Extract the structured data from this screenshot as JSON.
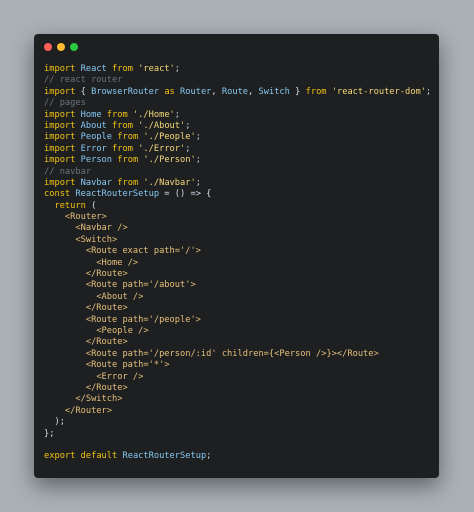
{
  "window": {
    "controls": [
      "close",
      "minimize",
      "zoom"
    ],
    "colors": {
      "background": "#1e1f21",
      "page": "#a9b0b6"
    }
  },
  "code": {
    "lines": [
      [
        [
          "kw",
          "import"
        ],
        [
          "plain",
          " "
        ],
        [
          "ident",
          "React"
        ],
        [
          "plain",
          " "
        ],
        [
          "kw",
          "from"
        ],
        [
          "plain",
          " "
        ],
        [
          "str",
          "'react'"
        ],
        [
          "punc",
          ";"
        ]
      ],
      [
        [
          "com",
          "// react router"
        ]
      ],
      [
        [
          "kw",
          "import"
        ],
        [
          "plain",
          " { "
        ],
        [
          "ident",
          "BrowserRouter"
        ],
        [
          "plain",
          " "
        ],
        [
          "kw",
          "as"
        ],
        [
          "plain",
          " "
        ],
        [
          "ident",
          "Router"
        ],
        [
          "plain",
          ", "
        ],
        [
          "ident",
          "Route"
        ],
        [
          "plain",
          ", "
        ],
        [
          "ident",
          "Switch"
        ],
        [
          "plain",
          " } "
        ],
        [
          "kw",
          "from"
        ],
        [
          "plain",
          " "
        ],
        [
          "str",
          "'react-router-dom'"
        ],
        [
          "punc",
          ";"
        ]
      ],
      [
        [
          "com",
          "// pages"
        ]
      ],
      [
        [
          "kw",
          "import"
        ],
        [
          "plain",
          " "
        ],
        [
          "ident",
          "Home"
        ],
        [
          "plain",
          " "
        ],
        [
          "kw",
          "from"
        ],
        [
          "plain",
          " "
        ],
        [
          "str",
          "'./Home'"
        ],
        [
          "punc",
          ";"
        ]
      ],
      [
        [
          "kw",
          "import"
        ],
        [
          "plain",
          " "
        ],
        [
          "ident",
          "About"
        ],
        [
          "plain",
          " "
        ],
        [
          "kw",
          "from"
        ],
        [
          "plain",
          " "
        ],
        [
          "str",
          "'./About'"
        ],
        [
          "punc",
          ";"
        ]
      ],
      [
        [
          "kw",
          "import"
        ],
        [
          "plain",
          " "
        ],
        [
          "ident",
          "People"
        ],
        [
          "plain",
          " "
        ],
        [
          "kw",
          "from"
        ],
        [
          "plain",
          " "
        ],
        [
          "str",
          "'./People'"
        ],
        [
          "punc",
          ";"
        ]
      ],
      [
        [
          "kw",
          "import"
        ],
        [
          "plain",
          " "
        ],
        [
          "ident",
          "Error"
        ],
        [
          "plain",
          " "
        ],
        [
          "kw",
          "from"
        ],
        [
          "plain",
          " "
        ],
        [
          "str",
          "'./Error'"
        ],
        [
          "punc",
          ";"
        ]
      ],
      [
        [
          "kw",
          "import"
        ],
        [
          "plain",
          " "
        ],
        [
          "ident",
          "Person"
        ],
        [
          "plain",
          " "
        ],
        [
          "kw",
          "from"
        ],
        [
          "plain",
          " "
        ],
        [
          "str",
          "'./Person'"
        ],
        [
          "punc",
          ";"
        ]
      ],
      [
        [
          "com",
          "// navbar"
        ]
      ],
      [
        [
          "kw",
          "import"
        ],
        [
          "plain",
          " "
        ],
        [
          "ident",
          "Navbar"
        ],
        [
          "plain",
          " "
        ],
        [
          "kw",
          "from"
        ],
        [
          "plain",
          " "
        ],
        [
          "str",
          "'./Navbar'"
        ],
        [
          "punc",
          ";"
        ]
      ],
      [
        [
          "kw",
          "const"
        ],
        [
          "plain",
          " "
        ],
        [
          "ident",
          "ReactRouterSetup"
        ],
        [
          "plain",
          " = () => {"
        ]
      ],
      [
        [
          "plain",
          "  "
        ],
        [
          "kw",
          "return"
        ],
        [
          "plain",
          " ("
        ]
      ],
      [
        [
          "plain",
          "    "
        ],
        [
          "tag",
          "<Router>"
        ]
      ],
      [
        [
          "plain",
          "      "
        ],
        [
          "tag",
          "<Navbar />"
        ]
      ],
      [
        [
          "plain",
          "      "
        ],
        [
          "tag",
          "<Switch>"
        ]
      ],
      [
        [
          "plain",
          "        "
        ],
        [
          "tag",
          "<Route exact path='/'>"
        ]
      ],
      [
        [
          "plain",
          "          "
        ],
        [
          "tag",
          "<Home />"
        ]
      ],
      [
        [
          "plain",
          "        "
        ],
        [
          "tag",
          "</Route>"
        ]
      ],
      [
        [
          "plain",
          "        "
        ],
        [
          "tag",
          "<Route path='/about'>"
        ]
      ],
      [
        [
          "plain",
          "          "
        ],
        [
          "tag",
          "<About />"
        ]
      ],
      [
        [
          "plain",
          "        "
        ],
        [
          "tag",
          "</Route>"
        ]
      ],
      [
        [
          "plain",
          "        "
        ],
        [
          "tag",
          "<Route path='/people'>"
        ]
      ],
      [
        [
          "plain",
          "          "
        ],
        [
          "tag",
          "<People />"
        ]
      ],
      [
        [
          "plain",
          "        "
        ],
        [
          "tag",
          "</Route>"
        ]
      ],
      [
        [
          "plain",
          "        "
        ],
        [
          "tag",
          "<Route path='/person/:id' children={<Person />}></Route>"
        ]
      ],
      [
        [
          "plain",
          "        "
        ],
        [
          "tag",
          "<Route path='*'>"
        ]
      ],
      [
        [
          "plain",
          "          "
        ],
        [
          "tag",
          "<Error />"
        ]
      ],
      [
        [
          "plain",
          "        "
        ],
        [
          "tag",
          "</Route>"
        ]
      ],
      [
        [
          "plain",
          "      "
        ],
        [
          "tag",
          "</Switch>"
        ]
      ],
      [
        [
          "plain",
          "    "
        ],
        [
          "tag",
          "</Router>"
        ]
      ],
      [
        [
          "plain",
          "  );"
        ]
      ],
      [
        [
          "plain",
          "};"
        ]
      ],
      [
        [
          "plain",
          ""
        ]
      ],
      [
        [
          "kw",
          "export"
        ],
        [
          "plain",
          " "
        ],
        [
          "kw",
          "default"
        ],
        [
          "plain",
          " "
        ],
        [
          "ident",
          "ReactRouterSetup"
        ],
        [
          "punc",
          ";"
        ]
      ]
    ]
  }
}
